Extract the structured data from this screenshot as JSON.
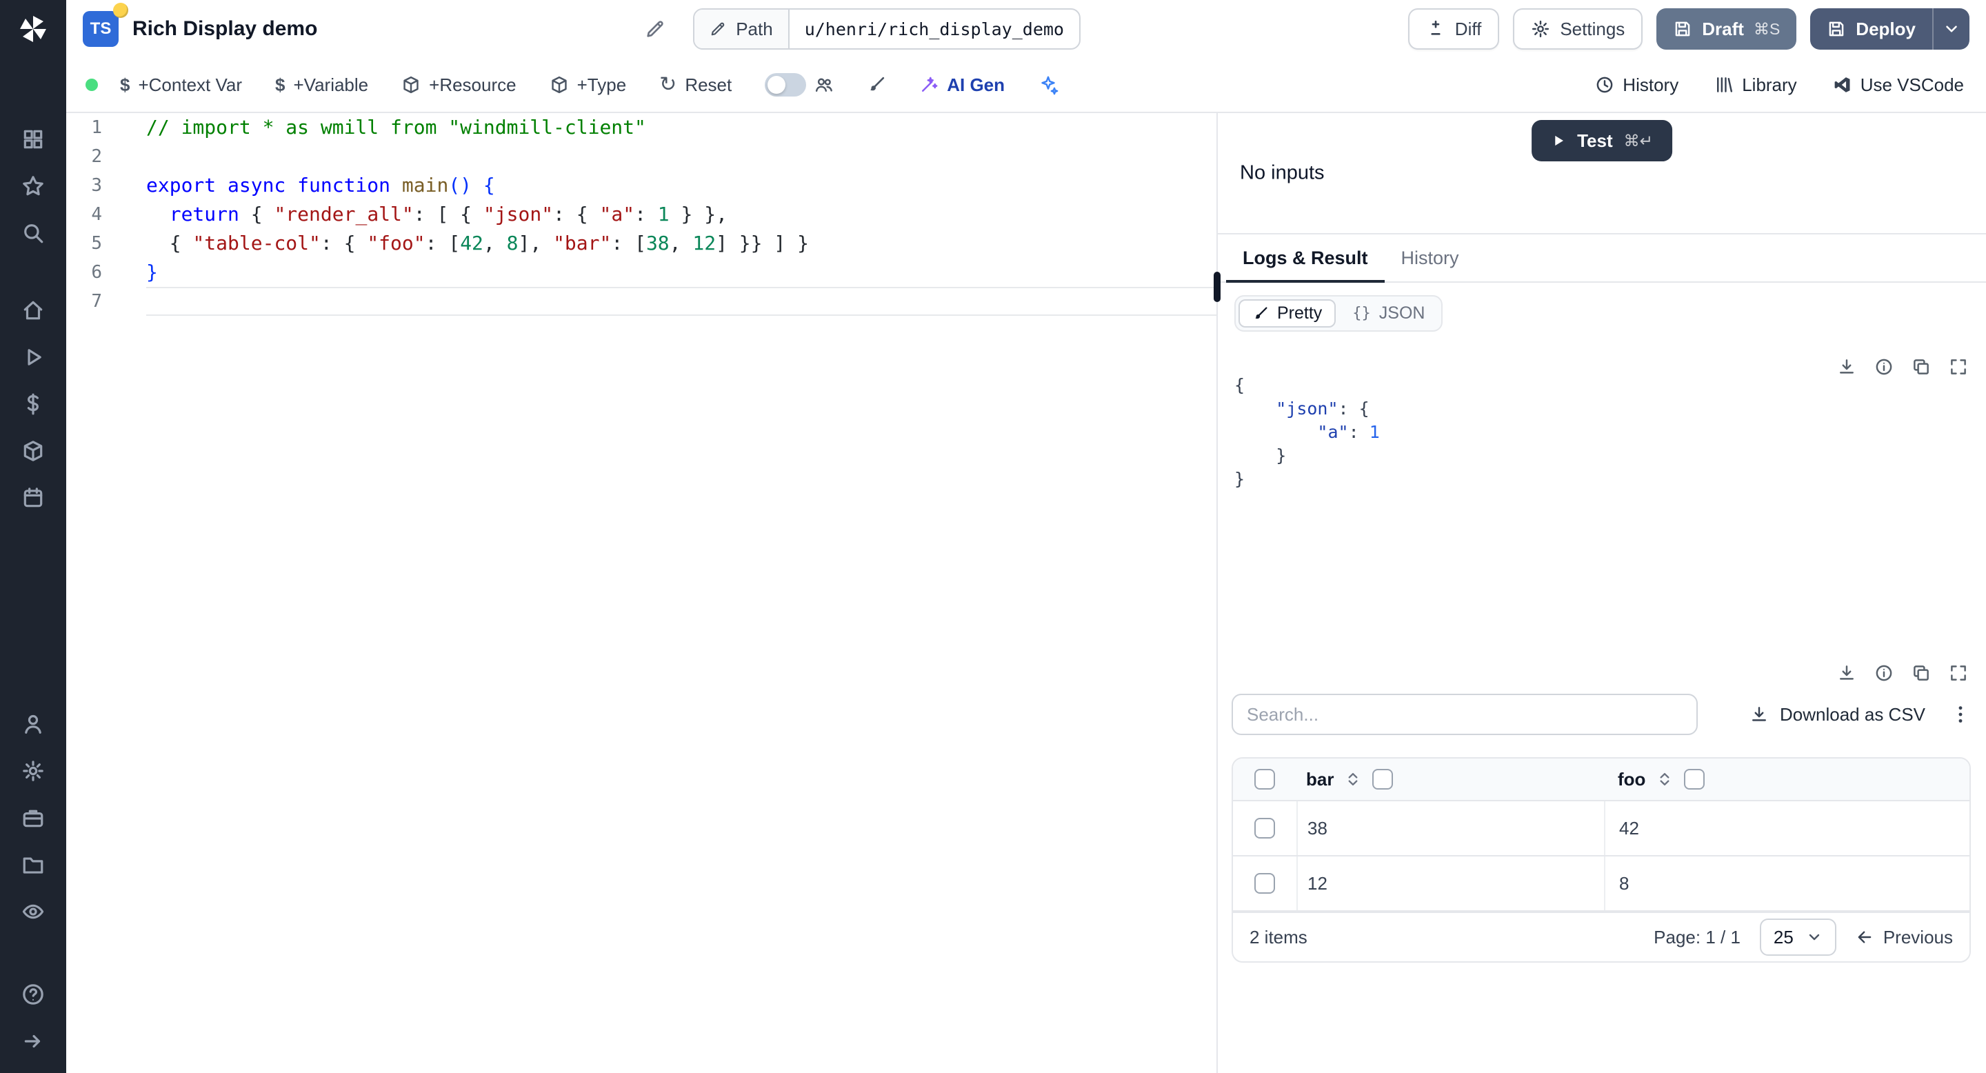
{
  "icons": {
    "dollar": "$",
    "reset": "↻",
    "braces": "{}"
  },
  "sidebar": {
    "icons": [
      "grid",
      "star",
      "search",
      "home",
      "play",
      "dollar",
      "cubes",
      "calendar",
      "user",
      "gear",
      "briefcase",
      "folder",
      "eye",
      "help",
      "arrow-right"
    ]
  },
  "header": {
    "logo": "TS",
    "title": "Rich Display demo",
    "path": {
      "label": "Path",
      "value": "u/henri/rich_display_demo"
    },
    "actions": {
      "diff": "Diff",
      "settings": "Settings",
      "draft": "Draft",
      "draft_shortcut": "⌘S",
      "deploy": "Deploy"
    }
  },
  "toolbar": {
    "left": [
      "+Context Var",
      "+Variable",
      "+Resource",
      "+Type",
      "Reset",
      "AI Gen"
    ],
    "right": [
      "History",
      "Library",
      "Use VSCode"
    ]
  },
  "editor": {
    "line_numbers": [
      "1",
      "2",
      "3",
      "4",
      "5",
      "6",
      "7"
    ],
    "lines": [
      [
        "// import * as wmill from \"windmill-client\""
      ],
      [],
      [
        "export async function ",
        "main",
        "() {"
      ],
      [
        "  ",
        "return",
        " { ",
        "\"render_all\"",
        ": [ { ",
        "\"json\"",
        ": { ",
        "\"a\"",
        ": ",
        "1",
        " } },"
      ],
      [
        "  { ",
        "\"table-col\"",
        ": { ",
        "\"foo\"",
        ": [",
        "42",
        ", ",
        "8",
        "], ",
        "\"bar\"",
        ": [",
        "38",
        ", ",
        "12",
        "] }} ] }"
      ],
      [
        "}"
      ],
      []
    ]
  },
  "run": {
    "no_inputs": "No inputs",
    "test": "Test",
    "test_shortcut": "⌘↵"
  },
  "result": {
    "tabs": [
      "Logs & Result",
      "History"
    ],
    "views": [
      "Pretty",
      "JSON"
    ],
    "json_lines": [
      [
        "{"
      ],
      [
        "    ",
        "\"json\"",
        ": {"
      ],
      [
        "        ",
        "\"a\"",
        ": ",
        "1"
      ],
      [
        "    }"
      ],
      [
        "}"
      ]
    ]
  },
  "table": {
    "search_placeholder": "Search...",
    "download_csv": "Download as CSV",
    "columns": [
      "bar",
      "foo"
    ],
    "rows": [
      [
        "38",
        "42"
      ],
      [
        "12",
        "8"
      ]
    ],
    "items_label": "2 items",
    "page_label": "Page: 1 / 1",
    "page_size": "25",
    "previous": "Previous"
  },
  "colors": {
    "sidebar_bg": "#1e242f",
    "status_green": "#4ade80",
    "draft_bg": "#64758d",
    "deploy_bg": "#4d5b77",
    "test_bg": "#2b3648",
    "ts_badge": "#2f6bd8"
  }
}
